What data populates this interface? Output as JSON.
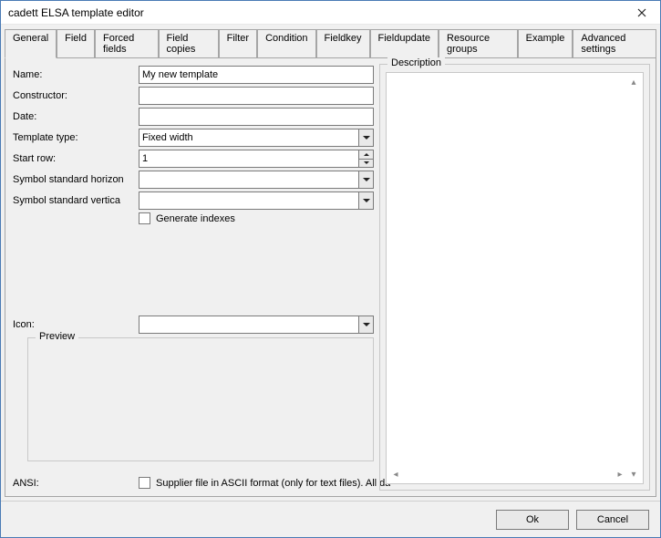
{
  "window": {
    "title": "cadett ELSA template editor"
  },
  "tabs": [
    "General",
    "Field",
    "Forced fields",
    "Field copies",
    "Filter",
    "Condition",
    "Fieldkey",
    "Fieldupdate",
    "Resource groups",
    "Example",
    "Advanced settings"
  ],
  "active_tab": 0,
  "form": {
    "name_label": "Name:",
    "name_value": "My new template",
    "constructor_label": "Constructor:",
    "constructor_value": "",
    "date_label": "Date:",
    "date_value": "",
    "template_type_label": "Template type:",
    "template_type_value": "Fixed width",
    "start_row_label": "Start row:",
    "start_row_value": "1",
    "sym_h_label": "Symbol standard horizon",
    "sym_h_value": "",
    "sym_v_label": "Symbol standard vertica",
    "sym_v_value": "",
    "gen_indexes_label": "Generate indexes",
    "icon_label": "Icon:",
    "icon_value": "",
    "preview_label": "Preview",
    "ansi_label": "ANSI:",
    "ansi_text": "Supplier file in ASCII format (only for text files). All da"
  },
  "description": {
    "label": "Description"
  },
  "buttons": {
    "ok": "Ok",
    "cancel": "Cancel"
  }
}
